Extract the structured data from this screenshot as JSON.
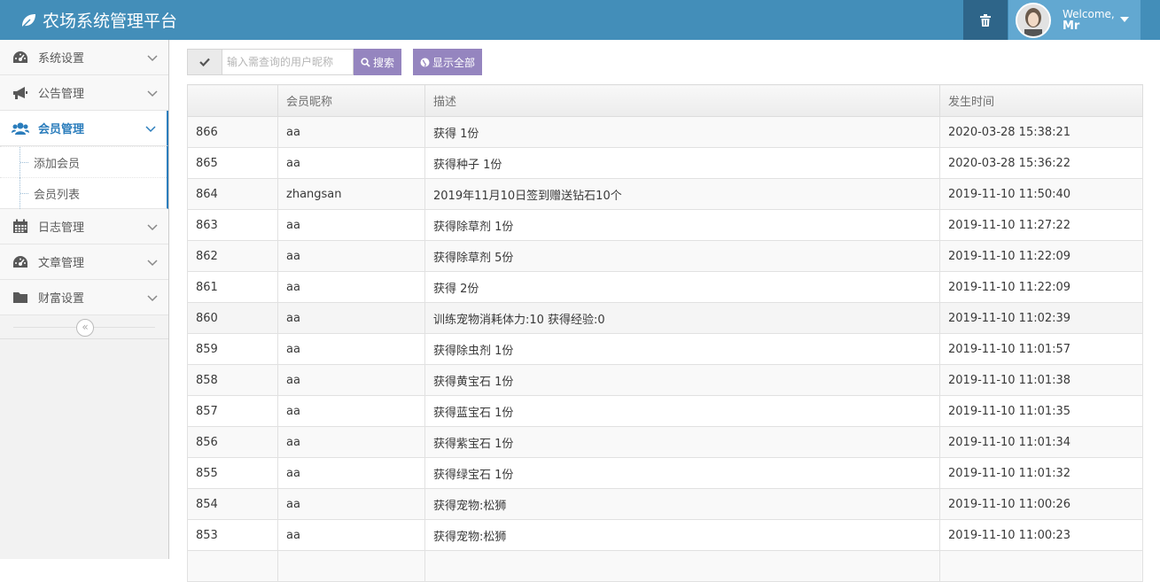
{
  "header": {
    "brand": "农场系统管理平台",
    "welcome": "Welcome,",
    "user_name": "Mr"
  },
  "sidebar": {
    "items": [
      {
        "label": "系统设置",
        "icon": "dashboard-icon"
      },
      {
        "label": "公告管理",
        "icon": "bullhorn-icon"
      },
      {
        "label": "会员管理",
        "icon": "users-icon",
        "active": true
      },
      {
        "label": "日志管理",
        "icon": "calendar-icon"
      },
      {
        "label": "文章管理",
        "icon": "dashboard-icon"
      },
      {
        "label": "财富设置",
        "icon": "folder-icon"
      }
    ],
    "submenu": [
      {
        "label": "添加会员"
      },
      {
        "label": "会员列表"
      }
    ],
    "collapse_glyph": "«"
  },
  "toolbar": {
    "search_placeholder": "输入需查询的用户昵称",
    "search_label": "搜索",
    "show_all_label": "显示全部"
  },
  "table": {
    "columns": [
      "",
      "会员昵称",
      "描述",
      "发生时间"
    ],
    "rows": [
      {
        "id": "866",
        "nick": "aa",
        "desc": "获得 1份",
        "time": "2020-03-28 15:38:21"
      },
      {
        "id": "865",
        "nick": "aa",
        "desc": "获得种子 1份",
        "time": "2020-03-28 15:36:22"
      },
      {
        "id": "864",
        "nick": "zhangsan",
        "desc": "2019年11月10日签到赠送钻石10个",
        "time": "2019-11-10 11:50:40"
      },
      {
        "id": "863",
        "nick": "aa",
        "desc": "获得除草剂 1份",
        "time": "2019-11-10 11:27:22"
      },
      {
        "id": "862",
        "nick": "aa",
        "desc": "获得除草剂 5份",
        "time": "2019-11-10 11:22:09"
      },
      {
        "id": "861",
        "nick": "aa",
        "desc": "获得 2份",
        "time": "2019-11-10 11:22:09"
      },
      {
        "id": "860",
        "nick": "aa",
        "desc": "训练宠物消耗体力:10 获得经验:0",
        "time": "2019-11-10 11:02:39"
      },
      {
        "id": "859",
        "nick": "aa",
        "desc": "获得除虫剂 1份",
        "time": "2019-11-10 11:01:57"
      },
      {
        "id": "858",
        "nick": "aa",
        "desc": "获得黄宝石 1份",
        "time": "2019-11-10 11:01:38"
      },
      {
        "id": "857",
        "nick": "aa",
        "desc": "获得蓝宝石 1份",
        "time": "2019-11-10 11:01:35"
      },
      {
        "id": "856",
        "nick": "aa",
        "desc": "获得紫宝石 1份",
        "time": "2019-11-10 11:01:34"
      },
      {
        "id": "855",
        "nick": "aa",
        "desc": "获得绿宝石 1份",
        "time": "2019-11-10 11:01:32"
      },
      {
        "id": "854",
        "nick": "aa",
        "desc": "获得宠物:松狮",
        "time": "2019-11-10 11:00:26"
      },
      {
        "id": "853",
        "nick": "aa",
        "desc": "获得宠物:松狮",
        "time": "2019-11-10 11:00:23"
      },
      {
        "id": "",
        "nick": "",
        "desc": "",
        "time": ""
      }
    ]
  }
}
